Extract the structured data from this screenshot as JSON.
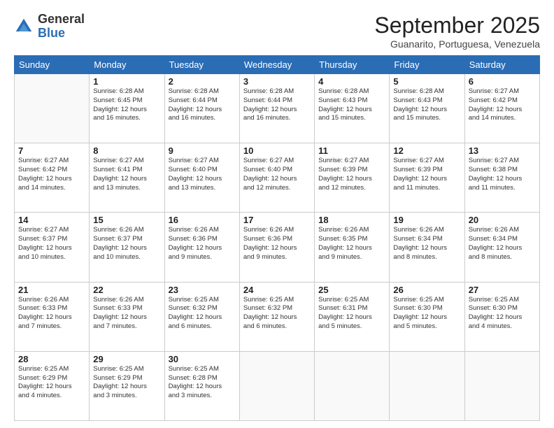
{
  "header": {
    "logo_general": "General",
    "logo_blue": "Blue",
    "title": "September 2025",
    "location": "Guanarito, Portuguesa, Venezuela"
  },
  "days_of_week": [
    "Sunday",
    "Monday",
    "Tuesday",
    "Wednesday",
    "Thursday",
    "Friday",
    "Saturday"
  ],
  "weeks": [
    [
      {
        "day": "",
        "info": ""
      },
      {
        "day": "1",
        "info": "Sunrise: 6:28 AM\nSunset: 6:45 PM\nDaylight: 12 hours\nand 16 minutes."
      },
      {
        "day": "2",
        "info": "Sunrise: 6:28 AM\nSunset: 6:44 PM\nDaylight: 12 hours\nand 16 minutes."
      },
      {
        "day": "3",
        "info": "Sunrise: 6:28 AM\nSunset: 6:44 PM\nDaylight: 12 hours\nand 16 minutes."
      },
      {
        "day": "4",
        "info": "Sunrise: 6:28 AM\nSunset: 6:43 PM\nDaylight: 12 hours\nand 15 minutes."
      },
      {
        "day": "5",
        "info": "Sunrise: 6:28 AM\nSunset: 6:43 PM\nDaylight: 12 hours\nand 15 minutes."
      },
      {
        "day": "6",
        "info": "Sunrise: 6:27 AM\nSunset: 6:42 PM\nDaylight: 12 hours\nand 14 minutes."
      }
    ],
    [
      {
        "day": "7",
        "info": "Sunrise: 6:27 AM\nSunset: 6:42 PM\nDaylight: 12 hours\nand 14 minutes."
      },
      {
        "day": "8",
        "info": "Sunrise: 6:27 AM\nSunset: 6:41 PM\nDaylight: 12 hours\nand 13 minutes."
      },
      {
        "day": "9",
        "info": "Sunrise: 6:27 AM\nSunset: 6:40 PM\nDaylight: 12 hours\nand 13 minutes."
      },
      {
        "day": "10",
        "info": "Sunrise: 6:27 AM\nSunset: 6:40 PM\nDaylight: 12 hours\nand 12 minutes."
      },
      {
        "day": "11",
        "info": "Sunrise: 6:27 AM\nSunset: 6:39 PM\nDaylight: 12 hours\nand 12 minutes."
      },
      {
        "day": "12",
        "info": "Sunrise: 6:27 AM\nSunset: 6:39 PM\nDaylight: 12 hours\nand 11 minutes."
      },
      {
        "day": "13",
        "info": "Sunrise: 6:27 AM\nSunset: 6:38 PM\nDaylight: 12 hours\nand 11 minutes."
      }
    ],
    [
      {
        "day": "14",
        "info": "Sunrise: 6:27 AM\nSunset: 6:37 PM\nDaylight: 12 hours\nand 10 minutes."
      },
      {
        "day": "15",
        "info": "Sunrise: 6:26 AM\nSunset: 6:37 PM\nDaylight: 12 hours\nand 10 minutes."
      },
      {
        "day": "16",
        "info": "Sunrise: 6:26 AM\nSunset: 6:36 PM\nDaylight: 12 hours\nand 9 minutes."
      },
      {
        "day": "17",
        "info": "Sunrise: 6:26 AM\nSunset: 6:36 PM\nDaylight: 12 hours\nand 9 minutes."
      },
      {
        "day": "18",
        "info": "Sunrise: 6:26 AM\nSunset: 6:35 PM\nDaylight: 12 hours\nand 9 minutes."
      },
      {
        "day": "19",
        "info": "Sunrise: 6:26 AM\nSunset: 6:34 PM\nDaylight: 12 hours\nand 8 minutes."
      },
      {
        "day": "20",
        "info": "Sunrise: 6:26 AM\nSunset: 6:34 PM\nDaylight: 12 hours\nand 8 minutes."
      }
    ],
    [
      {
        "day": "21",
        "info": "Sunrise: 6:26 AM\nSunset: 6:33 PM\nDaylight: 12 hours\nand 7 minutes."
      },
      {
        "day": "22",
        "info": "Sunrise: 6:26 AM\nSunset: 6:33 PM\nDaylight: 12 hours\nand 7 minutes."
      },
      {
        "day": "23",
        "info": "Sunrise: 6:25 AM\nSunset: 6:32 PM\nDaylight: 12 hours\nand 6 minutes."
      },
      {
        "day": "24",
        "info": "Sunrise: 6:25 AM\nSunset: 6:32 PM\nDaylight: 12 hours\nand 6 minutes."
      },
      {
        "day": "25",
        "info": "Sunrise: 6:25 AM\nSunset: 6:31 PM\nDaylight: 12 hours\nand 5 minutes."
      },
      {
        "day": "26",
        "info": "Sunrise: 6:25 AM\nSunset: 6:30 PM\nDaylight: 12 hours\nand 5 minutes."
      },
      {
        "day": "27",
        "info": "Sunrise: 6:25 AM\nSunset: 6:30 PM\nDaylight: 12 hours\nand 4 minutes."
      }
    ],
    [
      {
        "day": "28",
        "info": "Sunrise: 6:25 AM\nSunset: 6:29 PM\nDaylight: 12 hours\nand 4 minutes."
      },
      {
        "day": "29",
        "info": "Sunrise: 6:25 AM\nSunset: 6:29 PM\nDaylight: 12 hours\nand 3 minutes."
      },
      {
        "day": "30",
        "info": "Sunrise: 6:25 AM\nSunset: 6:28 PM\nDaylight: 12 hours\nand 3 minutes."
      },
      {
        "day": "",
        "info": ""
      },
      {
        "day": "",
        "info": ""
      },
      {
        "day": "",
        "info": ""
      },
      {
        "day": "",
        "info": ""
      }
    ]
  ]
}
